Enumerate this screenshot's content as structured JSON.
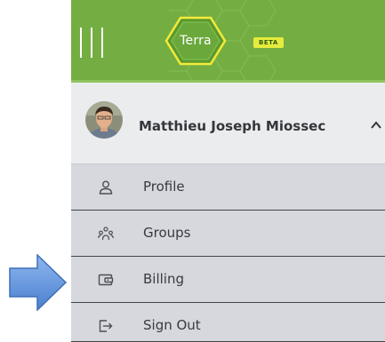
{
  "header": {
    "logo_text": "Terra",
    "beta_label": "BETA",
    "brand_color": "#74ae43"
  },
  "user": {
    "name": "Matthieu Joseph Miossec"
  },
  "menu": {
    "items": [
      {
        "label": "Profile",
        "icon": "person-icon"
      },
      {
        "label": "Groups",
        "icon": "groups-icon"
      },
      {
        "label": "Billing",
        "icon": "wallet-icon"
      },
      {
        "label": "Sign Out",
        "icon": "sign-out-icon"
      }
    ]
  },
  "annotation": {
    "arrow_color": "#5b8fd9",
    "points_to": "Billing"
  }
}
